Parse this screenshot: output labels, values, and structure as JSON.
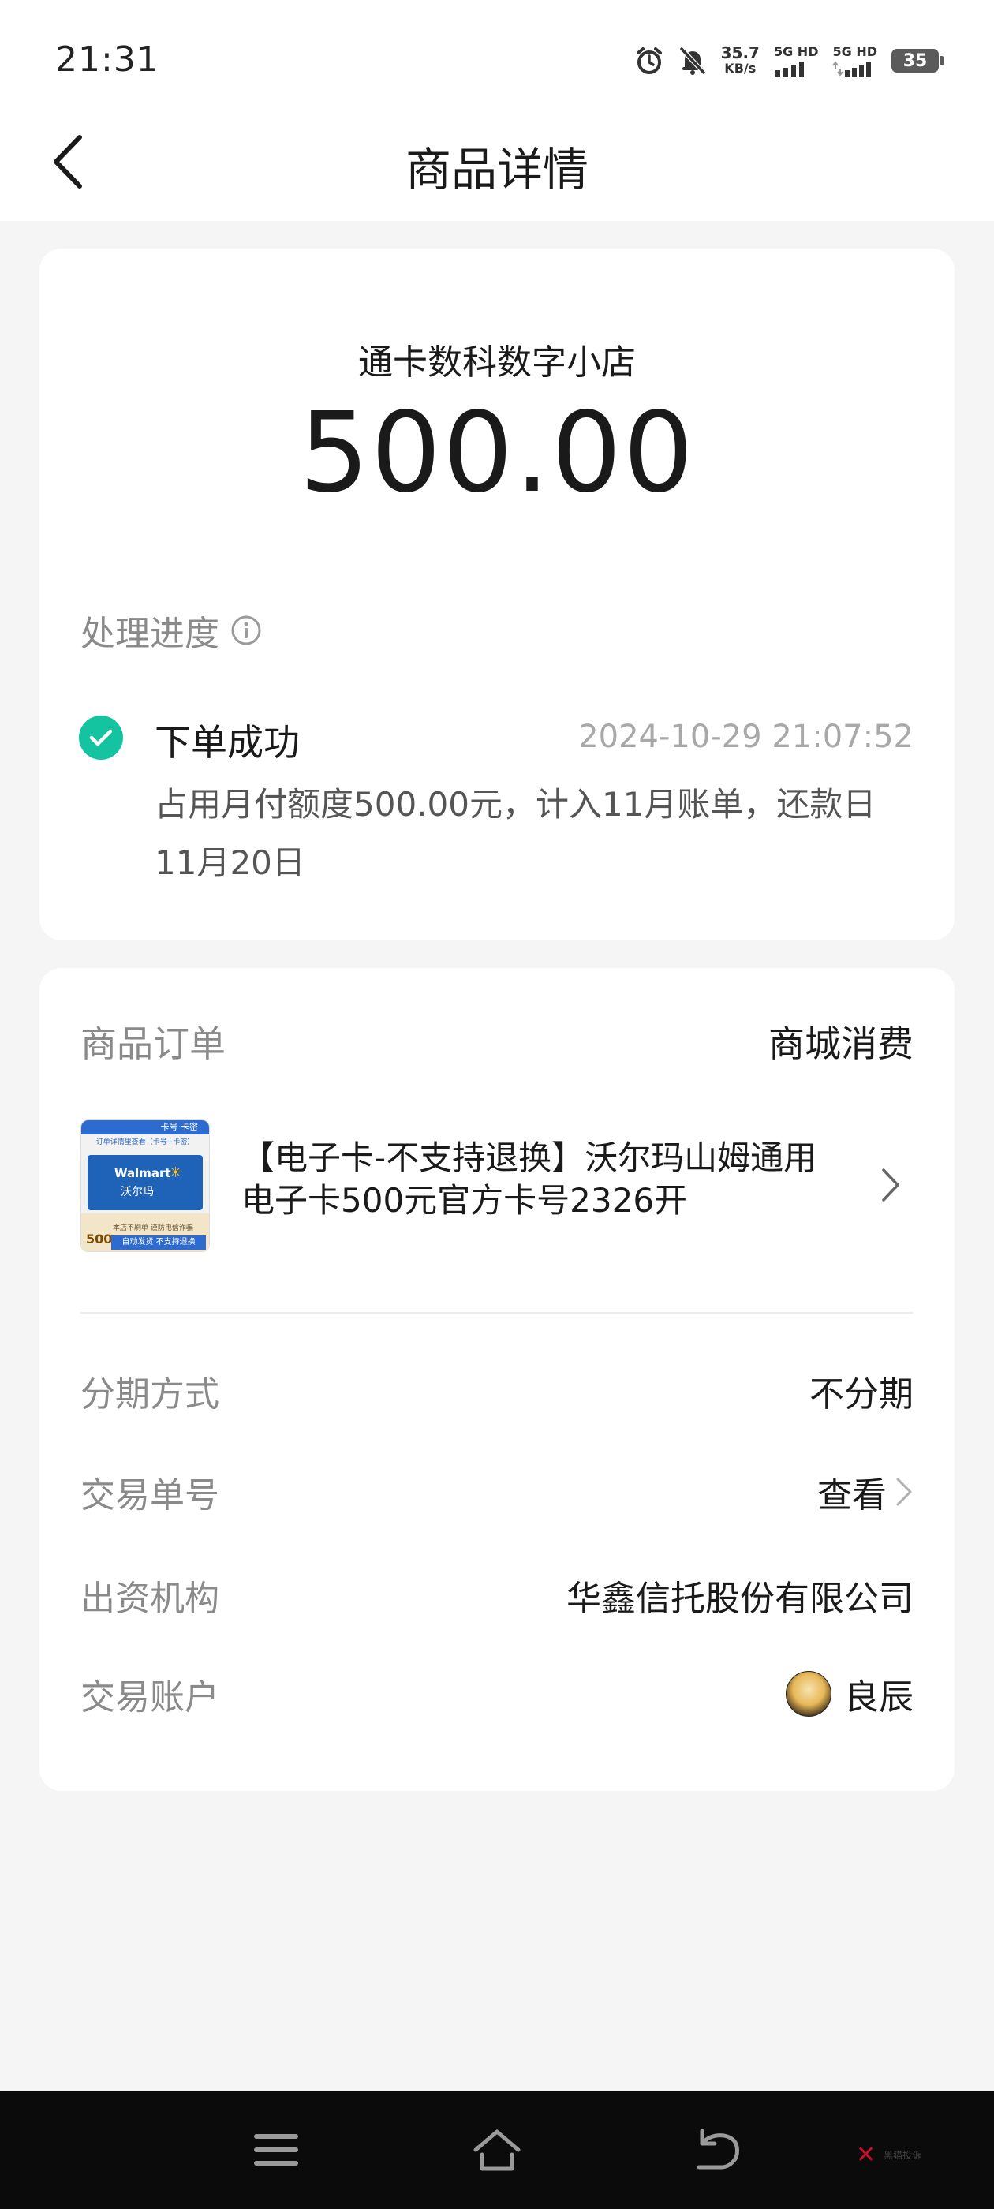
{
  "status_bar": {
    "time": "21:31",
    "net_speed_value": "35.7",
    "net_speed_unit": "KB/s",
    "sim1_label": "5G HD",
    "sim2_label": "5G HD",
    "battery": "35",
    "icons": [
      "alarm-icon",
      "mute-bell-icon",
      "signal-icon",
      "battery-icon"
    ]
  },
  "header": {
    "title": "商品详情",
    "back_icon": "chevron-left-icon"
  },
  "summary": {
    "merchant": "通卡数科数字小店",
    "amount": "500.00",
    "progress_label": "处理进度",
    "steps": [
      {
        "title": "下单成功",
        "time": "2024-10-29 21:07:52",
        "description": "占用月付额度500.00元，计入11月账单，还款日11月20日",
        "status_color": "#14c4a0"
      }
    ]
  },
  "order": {
    "label": "商品订单",
    "type": "商城消费",
    "product": {
      "name": "【电子卡-不支持退换】沃尔玛山姆通用电子卡500元官方卡号2326开",
      "thumb": {
        "corner": "卡号·卡密",
        "subtitle": "订单详情里查看（卡号+卡密）",
        "brand": "Walmart",
        "brand_cn": "沃尔玛",
        "price": "500",
        "note": "本店不刷单 谨防电信诈骗",
        "auto": "自动发货 不支持退换"
      }
    },
    "details": {
      "installment_label": "分期方式",
      "installment_value": "不分期",
      "txn_label": "交易单号",
      "txn_value": "查看",
      "funder_label": "出资机构",
      "funder_value": "华鑫信托股份有限公司",
      "account_label": "交易账户",
      "account_value": "良辰"
    }
  },
  "nav": {
    "watermark_text": "黑猫投诉"
  },
  "colors": {
    "accent": "#14c4a0",
    "background": "#f5f5f5",
    "card": "#ffffff",
    "muted_text": "#8a8a8a"
  }
}
